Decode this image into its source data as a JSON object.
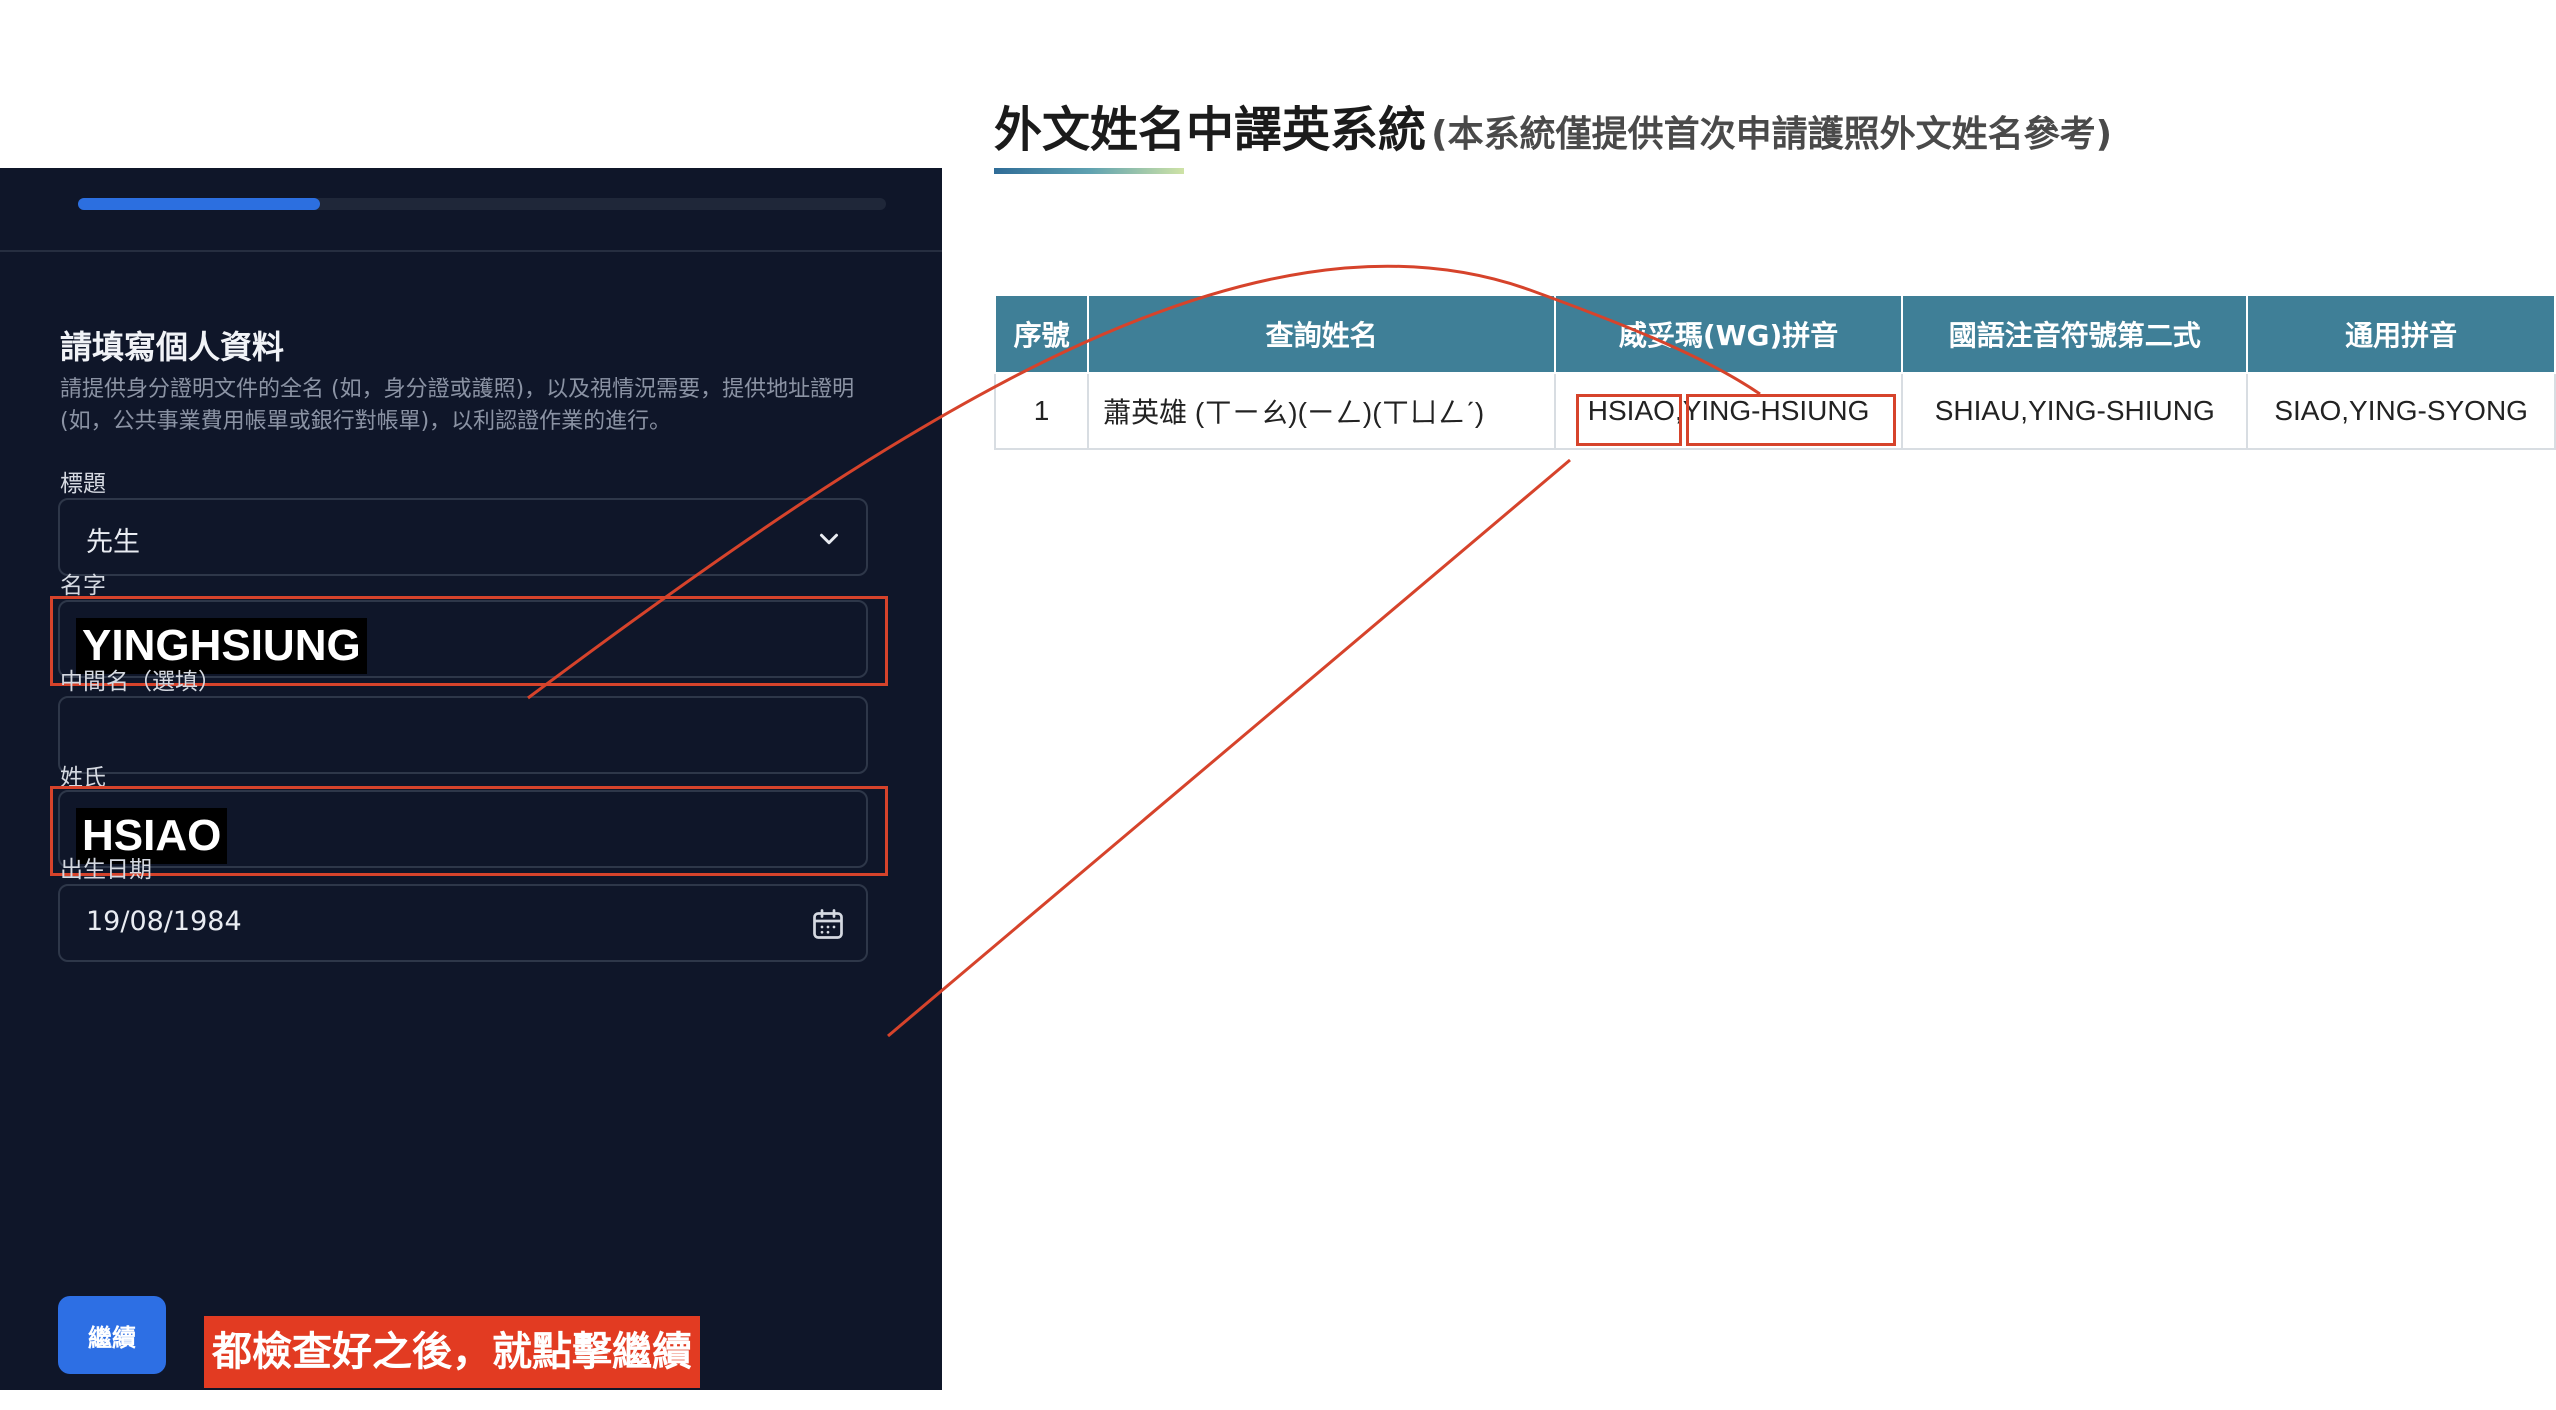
{
  "form": {
    "progress_fraction": 0.3,
    "heading": "請填寫個人資料",
    "description": "請提供身分證明文件的全名 (如，身分證或護照)，以及視情況需要，提供地址證明 (如，公共事業費用帳單或銀行對帳單)，以利認證作業的進行。",
    "title_label": "標題",
    "title_value": "先生",
    "first_name_label": "名字",
    "first_name_value": "YINGHSIUNG",
    "middle_name_label": "中間名（選填）",
    "middle_name_value": "",
    "last_name_label": "姓氏",
    "last_name_value": "HSIAO",
    "dob_label": "出生日期",
    "dob_value": "19/08/1984",
    "continue_label": "繼續",
    "icons": {
      "select": "chevron-down-icon",
      "date": "calendar-icon"
    }
  },
  "annotation": {
    "instruction": "都檢查好之後，就點擊繼續",
    "color": "#d6432b"
  },
  "translator": {
    "title": "外文姓名中譯英系統",
    "subtitle": "(本系統僅提供首次申請護照外文姓名參考)",
    "columns": [
      "序號",
      "查詢姓名",
      "威妥瑪(WG)拼音",
      "國語注音符號第二式",
      "通用拼音"
    ],
    "rows": [
      {
        "index": "1",
        "query_name": "蕭英雄 (ㄒㄧㄠ)(ㄧㄥ)(ㄒㄩㄥˊ)",
        "wg_surname": "HSIAO",
        "wg_given": "YING-HSIUNG",
        "mps2": "SHIAU,YING-SHIUNG",
        "tongyong": "SIAO,YING-SYONG"
      }
    ]
  },
  "colors": {
    "panel_bg": "#0f1629",
    "primary_button": "#2d6fe4",
    "table_header": "#3f7f97",
    "annotation_red": "#d6432b"
  }
}
